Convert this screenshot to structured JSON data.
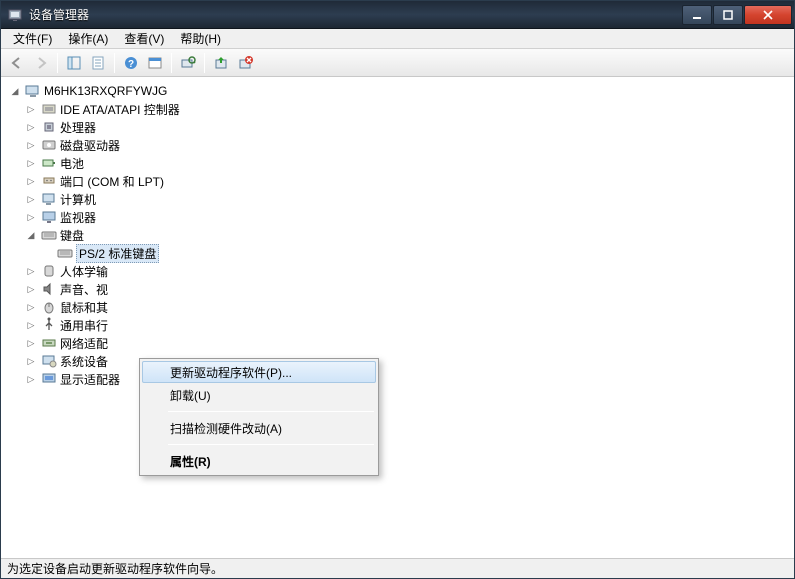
{
  "window": {
    "title": "设备管理器"
  },
  "menubar": [
    {
      "label": "文件(F)"
    },
    {
      "label": "操作(A)"
    },
    {
      "label": "查看(V)"
    },
    {
      "label": "帮助(H)"
    }
  ],
  "tree": {
    "root": {
      "label": "M6HK13RXQRFYWJG",
      "expanded": true
    },
    "nodes": [
      {
        "label": "IDE ATA/ATAPI 控制器",
        "icon": "ide-icon"
      },
      {
        "label": "处理器",
        "icon": "cpu-icon"
      },
      {
        "label": "磁盘驱动器",
        "icon": "disk-icon"
      },
      {
        "label": "电池",
        "icon": "battery-icon"
      },
      {
        "label": "端口 (COM 和 LPT)",
        "icon": "port-icon"
      },
      {
        "label": "计算机",
        "icon": "computer-icon"
      },
      {
        "label": "监视器",
        "icon": "monitor-icon"
      },
      {
        "label": "键盘",
        "icon": "keyboard-icon",
        "expanded": true,
        "children": [
          {
            "label": "PS/2 标准键盘",
            "icon": "keyboard-icon",
            "selected": true
          }
        ]
      },
      {
        "label": "人体学输",
        "icon": "hid-icon"
      },
      {
        "label": "声音、视",
        "icon": "sound-icon"
      },
      {
        "label": "鼠标和其",
        "icon": "mouse-icon"
      },
      {
        "label": "通用串行",
        "icon": "usb-icon"
      },
      {
        "label": "网络适配",
        "icon": "network-icon"
      },
      {
        "label": "系统设备",
        "icon": "system-icon"
      },
      {
        "label": "显示适配器",
        "icon": "display-icon"
      }
    ]
  },
  "context_menu": {
    "items": [
      {
        "label": "更新驱动程序软件(P)...",
        "highlighted": true
      },
      {
        "label": "卸载(U)"
      },
      {
        "sep": true
      },
      {
        "label": "扫描检测硬件改动(A)"
      },
      {
        "sep": true
      },
      {
        "label": "属性(R)",
        "bold": true
      }
    ]
  },
  "statusbar": {
    "text": "为选定设备启动更新驱动程序软件向导。"
  }
}
